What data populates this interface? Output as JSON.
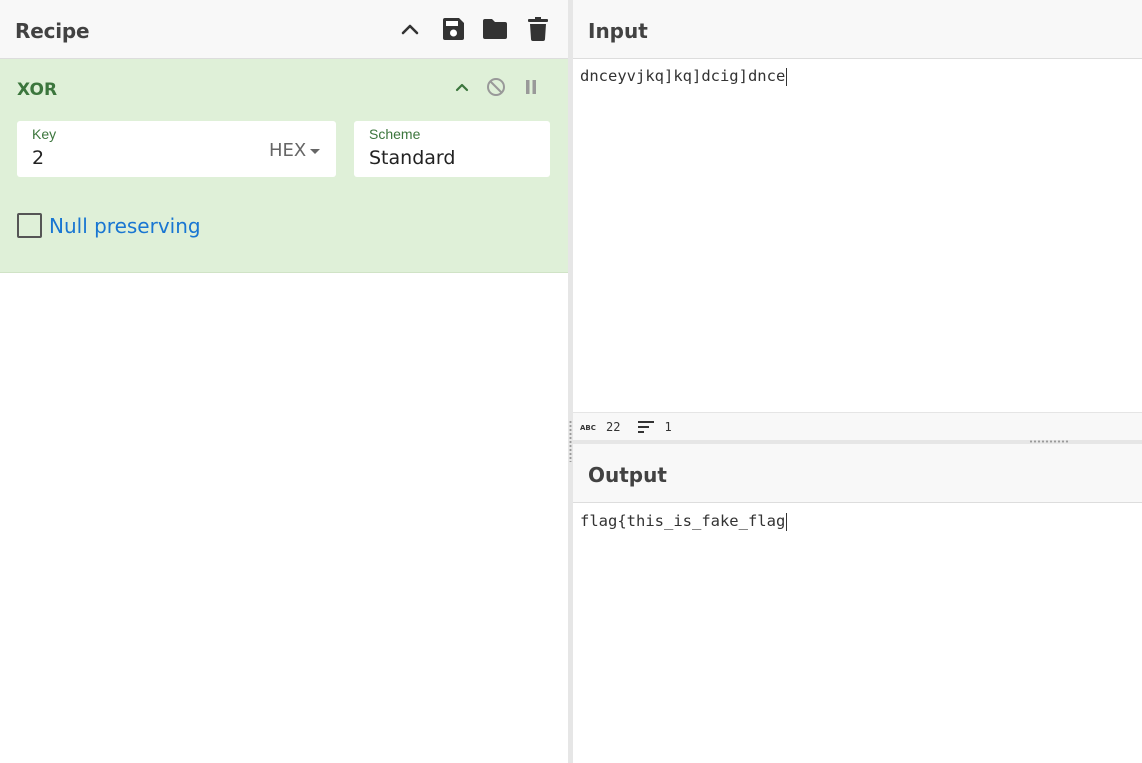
{
  "recipe": {
    "title": "Recipe",
    "operation": {
      "name": "XOR",
      "key": {
        "label": "Key",
        "value": "2",
        "format": "HEX"
      },
      "scheme": {
        "label": "Scheme",
        "value": "Standard"
      },
      "null_preserving": {
        "label": "Null preserving",
        "checked": false
      }
    }
  },
  "input": {
    "title": "Input",
    "text": "dnceyvjkq]kq]dcig]dnce",
    "stats": {
      "chars": "22",
      "lines": "1"
    }
  },
  "output": {
    "title": "Output",
    "text": "flag{this_is_fake_flag"
  },
  "colors": {
    "operation_bg": "#dff0d8",
    "operation_title": "#3c763d",
    "link_blue": "#1976d2"
  }
}
